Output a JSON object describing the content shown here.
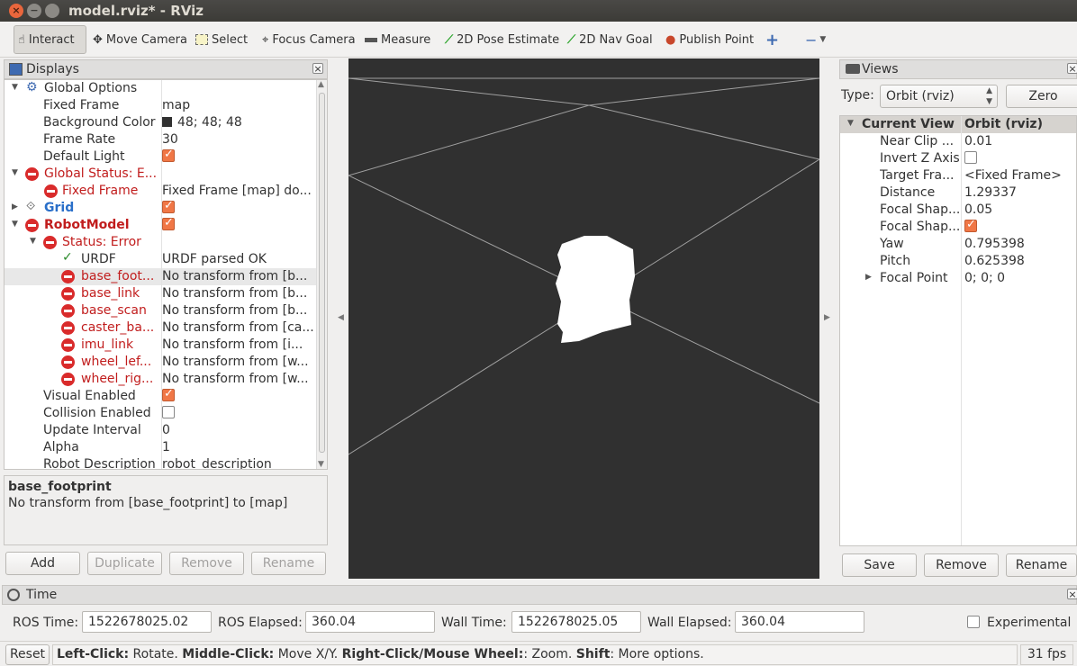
{
  "window": {
    "title": "model.rviz* - RViz"
  },
  "toolbar": {
    "tools": [
      {
        "label": "Interact",
        "icon": "hand-icon"
      },
      {
        "label": "Move Camera",
        "icon": "move-camera-icon"
      },
      {
        "label": "Select",
        "icon": "select-icon"
      },
      {
        "label": "Focus Camera",
        "icon": "focus-camera-icon"
      },
      {
        "label": "Measure",
        "icon": "measure-icon"
      },
      {
        "label": "2D Pose Estimate",
        "icon": "pose-estimate-icon"
      },
      {
        "label": "2D Nav Goal",
        "icon": "nav-goal-icon"
      },
      {
        "label": "Publish Point",
        "icon": "publish-point-icon"
      }
    ],
    "active": "Interact"
  },
  "displays": {
    "title": "Displays",
    "rows": [
      {
        "name": "Global Options",
        "value": ""
      },
      {
        "name": "Fixed Frame",
        "value": "map"
      },
      {
        "name": "Background Color",
        "value": "48; 48; 48"
      },
      {
        "name": "Frame Rate",
        "value": "30"
      },
      {
        "name": "Default Light",
        "value": ""
      },
      {
        "name": "Global Status: E...",
        "value": ""
      },
      {
        "name": "Fixed Frame",
        "value": "Fixed Frame [map] do..."
      },
      {
        "name": "Grid",
        "value": ""
      },
      {
        "name": "RobotModel",
        "value": ""
      },
      {
        "name": "Status: Error",
        "value": ""
      },
      {
        "name": "URDF",
        "value": "URDF parsed OK"
      },
      {
        "name": "base_foot...",
        "value": "No transform from [b..."
      },
      {
        "name": "base_link",
        "value": "No transform from [b..."
      },
      {
        "name": "base_scan",
        "value": "No transform from [b..."
      },
      {
        "name": "caster_ba...",
        "value": "No transform from [ca..."
      },
      {
        "name": "imu_link",
        "value": "No transform from [i..."
      },
      {
        "name": "wheel_lef...",
        "value": "No transform from [w..."
      },
      {
        "name": "wheel_rig...",
        "value": "No transform from [w..."
      },
      {
        "name": "Visual Enabled",
        "value": ""
      },
      {
        "name": "Collision Enabled",
        "value": ""
      },
      {
        "name": "Update Interval",
        "value": "0"
      },
      {
        "name": "Alpha",
        "value": "1"
      },
      {
        "name": "Robot Description",
        "value": "robot_description"
      }
    ],
    "description": {
      "title": "base_footprint",
      "text": "No transform from [base_footprint] to [map]"
    },
    "buttons": {
      "add": "Add",
      "duplicate": "Duplicate",
      "remove": "Remove",
      "rename": "Rename"
    }
  },
  "views": {
    "title": "Views",
    "type_label": "Type:",
    "type_value": "Orbit (rviz)",
    "zero": "Zero",
    "header": {
      "name": "Current View",
      "value": "Orbit (rviz)"
    },
    "rows": [
      {
        "name": "Near Clip ...",
        "value": "0.01"
      },
      {
        "name": "Invert Z Axis",
        "value": ""
      },
      {
        "name": "Target Fra...",
        "value": "<Fixed Frame>"
      },
      {
        "name": "Distance",
        "value": "1.29337"
      },
      {
        "name": "Focal Shap...",
        "value": "0.05"
      },
      {
        "name": "Focal Shap...",
        "value": ""
      },
      {
        "name": "Yaw",
        "value": "0.795398"
      },
      {
        "name": "Pitch",
        "value": "0.625398"
      },
      {
        "name": "Focal Point",
        "value": "0; 0; 0"
      }
    ],
    "buttons": {
      "save": "Save",
      "remove": "Remove",
      "rename": "Rename"
    }
  },
  "time": {
    "title": "Time",
    "ros_time_label": "ROS Time:",
    "ros_time": "1522678025.02",
    "ros_elapsed_label": "ROS Elapsed:",
    "ros_elapsed": "360.04",
    "wall_time_label": "Wall Time:",
    "wall_time": "1522678025.05",
    "wall_elapsed_label": "Wall Elapsed:",
    "wall_elapsed": "360.04",
    "experimental": "Experimental"
  },
  "statusbar": {
    "reset": "Reset",
    "help_b1": "Left-Click:",
    "help_t1": " Rotate. ",
    "help_b2": "Middle-Click:",
    "help_t2": " Move X/Y. ",
    "help_b3": "Right-Click/Mouse Wheel:",
    "help_t3": ": Zoom. ",
    "help_b4": "Shift",
    "help_t4": ": More options.",
    "fps": "31 fps"
  },
  "colors": {
    "viewport_bg": "#303030",
    "error": "#c11d1d",
    "grid": "#3e6ab1",
    "checkbox": "#f07746"
  }
}
